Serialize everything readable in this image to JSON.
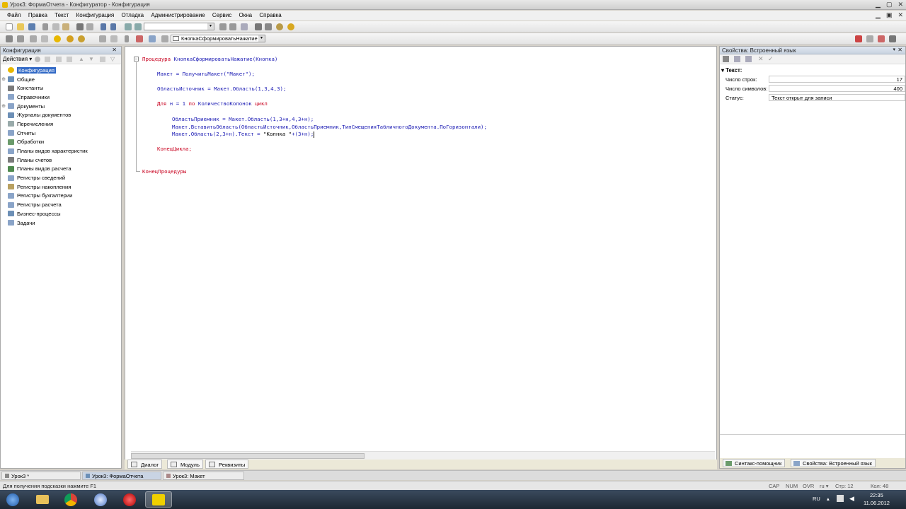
{
  "window": {
    "title": "Урок3: ФормаОтчета - Конфигуратор - Конфигурация"
  },
  "menu": [
    "Файл",
    "Правка",
    "Текст",
    "Конфигурация",
    "Отладка",
    "Администрирование",
    "Сервис",
    "Окна",
    "Справка"
  ],
  "toolbar2": {
    "procedure_select": "КнопкаСформироватьНажатие"
  },
  "config_panel": {
    "title": "Конфигурация",
    "actions_label": "Действия ▾",
    "items": [
      {
        "label": "Конфигурация",
        "selected": true,
        "expandable": false,
        "icon_color": "#e8b800"
      },
      {
        "label": "Общие",
        "expandable": true,
        "icon_color": "#6a8fb8"
      },
      {
        "label": "Константы",
        "expandable": false,
        "icon_color": "#7a7a7a"
      },
      {
        "label": "Справочники",
        "expandable": false,
        "icon_color": "#8aa4c8"
      },
      {
        "label": "Документы",
        "expandable": true,
        "icon_color": "#8aa4c8"
      },
      {
        "label": "Журналы документов",
        "expandable": false,
        "icon_color": "#6c8fb6"
      },
      {
        "label": "Перечисления",
        "expandable": false,
        "icon_color": "#9aa"
      },
      {
        "label": "Отчеты",
        "expandable": false,
        "icon_color": "#8aa4c8"
      },
      {
        "label": "Обработки",
        "expandable": false,
        "icon_color": "#6b9b6b"
      },
      {
        "label": "Планы видов характеристик",
        "expandable": false,
        "icon_color": "#8aa4c8"
      },
      {
        "label": "Планы счетов",
        "expandable": false,
        "icon_color": "#7a7a7a"
      },
      {
        "label": "Планы видов расчета",
        "expandable": false,
        "icon_color": "#4f8a4f"
      },
      {
        "label": "Регистры сведений",
        "expandable": false,
        "icon_color": "#8aa4c8"
      },
      {
        "label": "Регистры накопления",
        "expandable": false,
        "icon_color": "#b8a060"
      },
      {
        "label": "Регистры бухгалтерии",
        "expandable": false,
        "icon_color": "#8aa4c8"
      },
      {
        "label": "Регистры расчета",
        "expandable": false,
        "icon_color": "#8aa4c8"
      },
      {
        "label": "Бизнес-процессы",
        "expandable": false,
        "icon_color": "#6c8fb6"
      },
      {
        "label": "Задачи",
        "expandable": false,
        "icon_color": "#8aa4c8"
      }
    ]
  },
  "code": {
    "l1_kw": "Процедура",
    "l1_name": "КнопкаСформироватьНажатие",
    "l1_args": "(Кнопка)",
    "l2": "Макет = ПолучитьМакет(\"Макет\");",
    "l3": "ОбластьИсточник = Макет.Область(1,3,4,3);",
    "l4_a": "Для",
    "l4_b": " н = 1 ",
    "l4_c": "по",
    "l4_d": " КоличествоКолонок ",
    "l4_e": "цикл",
    "l5": "ОбластьПриемник = Макет.Область(1,3+н,4,3+н);",
    "l6": "Макет.ВставитьОбласть(ОбластьИсточник,ОбластьПриемник,ТипСмещенияТабличногоДокумента.ПоГоризонтали);",
    "l7_a": "Макет.Область(2,3+н).Текст = ",
    "l7_b": "\"Колнка \"",
    "l7_c": "+(3+н);",
    "l8": "КонецЦикла;",
    "l9": "КонецПроцедуры"
  },
  "editor_tabs": [
    "Диалог",
    "Модуль",
    "Реквизиты"
  ],
  "properties": {
    "title": "Свойства: Встроенный язык",
    "section": "Текст:",
    "rows": [
      {
        "label": "Число строк:",
        "value": "17"
      },
      {
        "label": "Число символов:",
        "value": "400"
      },
      {
        "label": "Статус:",
        "value": "Текст открыт для записи"
      }
    ],
    "tabs": [
      "Синтакс-помощник",
      "Свойства: Встроенный язык"
    ]
  },
  "window_tabs": [
    "Урок3 *",
    "Урок3: ФормаОтчета",
    "Урок3: Макет"
  ],
  "status": {
    "hint": "Для получения подсказки нажмите F1",
    "cap": "CAP",
    "num": "NUM",
    "ovr": "OVR",
    "lang": "ru ▾",
    "line": "Стр: 12",
    "col": "Кол: 48"
  },
  "taskbar": {
    "lang": "RU",
    "time": "22:35",
    "date": "11.06.2012"
  }
}
